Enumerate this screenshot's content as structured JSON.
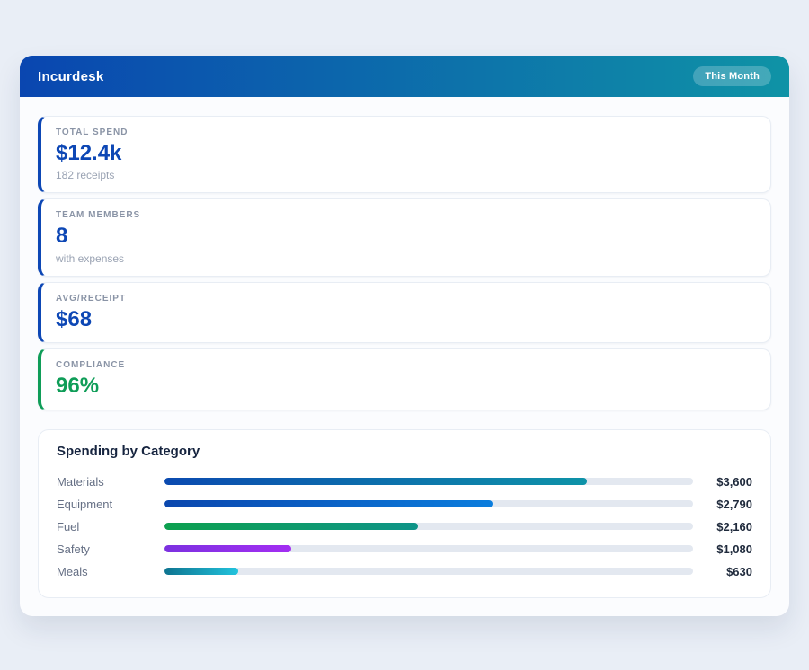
{
  "header": {
    "title": "Incurdesk",
    "badge": "This Month"
  },
  "stats": [
    {
      "label": "TOTAL SPEND",
      "value": "$12.4k",
      "subtitle": "182 receipts",
      "accent": "#0d47b5",
      "value_color": "#0d47b5"
    },
    {
      "label": "TEAM MEMBERS",
      "value": "8",
      "subtitle": "with expenses",
      "accent": "#0d47b5",
      "value_color": "#0d47b5"
    },
    {
      "label": "AVG/RECEIPT",
      "value": "$68",
      "subtitle": "",
      "accent": "#0d47b5",
      "value_color": "#0d47b5"
    },
    {
      "label": "COMPLIANCE",
      "value": "96%",
      "subtitle": "",
      "accent": "#0f9d58",
      "value_color": "#0f9d58"
    }
  ],
  "chart_data": {
    "type": "bar",
    "orientation": "horizontal",
    "title": "Spending by Category",
    "categories": [
      "Materials",
      "Equipment",
      "Fuel",
      "Safety",
      "Meals"
    ],
    "values": [
      3600,
      2790,
      2160,
      1080,
      630
    ],
    "value_labels": [
      "$3,600",
      "$2,790",
      "$2,160",
      "$1,080",
      "$630"
    ],
    "xlim": [
      0,
      4500
    ],
    "grid": false,
    "track_color": "#e3e8f0",
    "bar_gradients": [
      {
        "from": "#0b4ab0",
        "to": "#0e93a8"
      },
      {
        "from": "#0b47ae",
        "to": "#0b7ddd"
      },
      {
        "from": "#0da04f",
        "to": "#0e9488"
      },
      {
        "from": "#7c31e0",
        "to": "#a32ef2"
      },
      {
        "from": "#0e7490",
        "to": "#22c3dd"
      }
    ]
  },
  "colors": {
    "page_background": "#e9eef6",
    "panel_background": "#fbfcfe",
    "header_gradient_from": "#0a46b0",
    "header_gradient_to": "#0f93a6",
    "stat_accent_blue": "#0d47b5",
    "stat_accent_green": "#0f9d58"
  }
}
